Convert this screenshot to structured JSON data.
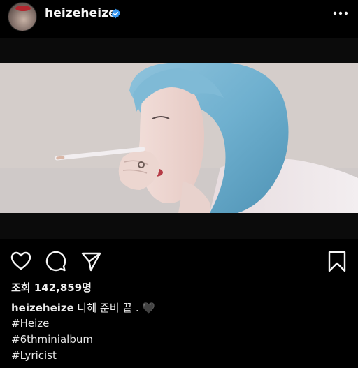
{
  "post": {
    "username": "heizeheize",
    "verified": true,
    "views_label": "조회 142,859명",
    "caption_user": "heizeheize",
    "caption_text": " 다헤 준비 끝 . 🖤",
    "hashtags": [
      "#Heize",
      "#6thminialbum",
      "#Lyricist"
    ]
  },
  "icons": {
    "more": "more-dots-icon",
    "like": "heart-icon",
    "comment": "comment-icon",
    "share": "send-icon",
    "save": "bookmark-icon",
    "verified": "verified-badge-icon"
  },
  "colors": {
    "background": "#000000",
    "verified_badge": "#3897f0",
    "text": "#f2f2f2"
  }
}
